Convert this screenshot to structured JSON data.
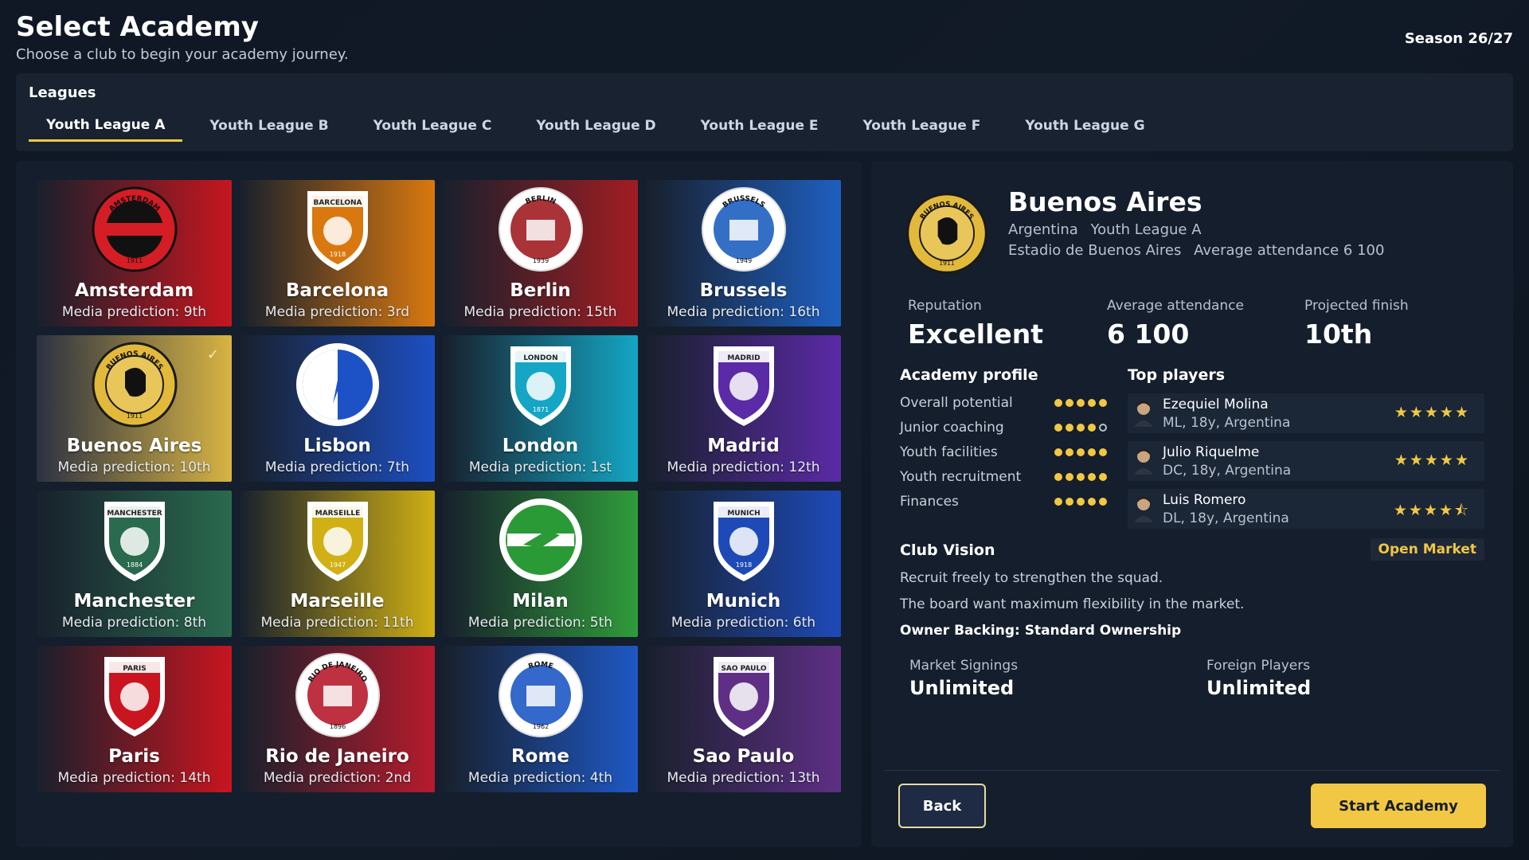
{
  "header": {
    "title": "Select Academy",
    "subtitle": "Choose a club to begin your academy journey.",
    "season": "Season 26/27"
  },
  "leagues": {
    "label": "Leagues",
    "tabs": [
      "Youth League A",
      "Youth League B",
      "Youth League C",
      "Youth League D",
      "Youth League E",
      "Youth League F",
      "Youth League G"
    ],
    "active": "Youth League A"
  },
  "clubs": [
    {
      "name": "Amsterdam",
      "prediction": "Media prediction: 9th",
      "crest_text": "AMSTERDAM",
      "crest_year": "1911",
      "color": "#c6161f"
    },
    {
      "name": "Barcelona",
      "prediction": "Media prediction: 3rd",
      "crest_text": "BARCELONA",
      "crest_year": "1918",
      "color": "#d9780f"
    },
    {
      "name": "Berlin",
      "prediction": "Media prediction: 15th",
      "crest_text": "BERLIN",
      "crest_year": "1939",
      "color": "#a11d22"
    },
    {
      "name": "Brussels",
      "prediction": "Media prediction: 16th",
      "crest_text": "BRUSSELS",
      "crest_year": "1949",
      "color": "#1e5fc0"
    },
    {
      "name": "Buenos Aires",
      "prediction": "Media prediction: 10th",
      "crest_text": "BUENOS AIRES",
      "crest_year": "1911",
      "color": "#d8b443"
    },
    {
      "name": "Lisbon",
      "prediction": "Media prediction: 7th",
      "crest_text": "",
      "crest_year": "",
      "color": "#1d4fc2"
    },
    {
      "name": "London",
      "prediction": "Media prediction: 1st",
      "crest_text": "LONDON",
      "crest_year": "1871",
      "color": "#14a6c4"
    },
    {
      "name": "Madrid",
      "prediction": "Media prediction: 12th",
      "crest_text": "MADRID",
      "crest_year": "",
      "color": "#5b2aa6"
    },
    {
      "name": "Manchester",
      "prediction": "Media prediction: 8th",
      "crest_text": "MANCHESTER",
      "crest_year": "1884",
      "color": "#2a6a4e"
    },
    {
      "name": "Marseille",
      "prediction": "Media prediction: 11th",
      "crest_text": "MARSEILLE",
      "crest_year": "1947",
      "color": "#d0b014"
    },
    {
      "name": "Milan",
      "prediction": "Media prediction: 5th",
      "crest_text": "",
      "crest_year": "",
      "color": "#2f9c3a"
    },
    {
      "name": "Munich",
      "prediction": "Media prediction: 6th",
      "crest_text": "MUNICH",
      "crest_year": "1918",
      "color": "#1e4ab8"
    },
    {
      "name": "Paris",
      "prediction": "Media prediction: 14th",
      "crest_text": "PARIS",
      "crest_year": "",
      "color": "#c8151f"
    },
    {
      "name": "Rio de Janeiro",
      "prediction": "Media prediction: 2nd",
      "crest_text": "RIO DE JANEIRO",
      "crest_year": "1896",
      "color": "#b71b2c"
    },
    {
      "name": "Rome",
      "prediction": "Media prediction: 4th",
      "crest_text": "ROME",
      "crest_year": "1962",
      "color": "#1e58c4"
    },
    {
      "name": "Sao Paulo",
      "prediction": "Media prediction: 13th",
      "crest_text": "SAO PAULO",
      "crest_year": "",
      "color": "#5e2f85"
    }
  ],
  "selected": {
    "name": "Buenos Aires",
    "country": "Argentina",
    "league": "Youth League A",
    "stadium": "Estadio de Buenos Aires",
    "attendance_text": "Average attendance 6 100",
    "crest_text": "BUENOS AIRES",
    "crest_year": "1911",
    "stats": [
      {
        "label": "Reputation",
        "value": "Excellent"
      },
      {
        "label": "Average attendance",
        "value": "6 100"
      },
      {
        "label": "Projected finish",
        "value": "10th"
      }
    ],
    "profile_title": "Academy profile",
    "profile": [
      {
        "label": "Overall potential",
        "rating": 5
      },
      {
        "label": "Junior coaching",
        "rating": 4
      },
      {
        "label": "Youth facilities",
        "rating": 5
      },
      {
        "label": "Youth recruitment",
        "rating": 5
      },
      {
        "label": "Finances",
        "rating": 5
      }
    ],
    "players_title": "Top players",
    "players": [
      {
        "name": "Ezequiel Molina",
        "info": "ML, 18y, Argentina",
        "stars": "★★★★★",
        "rating": 5
      },
      {
        "name": "Julio Riquelme",
        "info": "DC, 18y, Argentina",
        "stars": "★★★★★",
        "rating": 5
      },
      {
        "name": "Luis Romero",
        "info": "DL, 18y, Argentina",
        "stars": "★★★★⯪",
        "rating": 4.5
      }
    ],
    "vision_title": "Club Vision",
    "vision_badge": "Open Market",
    "vision_lines": [
      "Recruit freely to strengthen the squad.",
      "The board want maximum flexibility in the market."
    ],
    "owner": "Owner Backing: Standard Ownership",
    "signings": [
      {
        "label": "Market Signings",
        "value": "Unlimited"
      },
      {
        "label": "Foreign Players",
        "value": "Unlimited"
      }
    ]
  },
  "buttons": {
    "back": "Back",
    "start": "Start Academy"
  },
  "colors": {
    "accent": "#f2c744",
    "panel": "#141e2c",
    "background": "#0f1824"
  }
}
